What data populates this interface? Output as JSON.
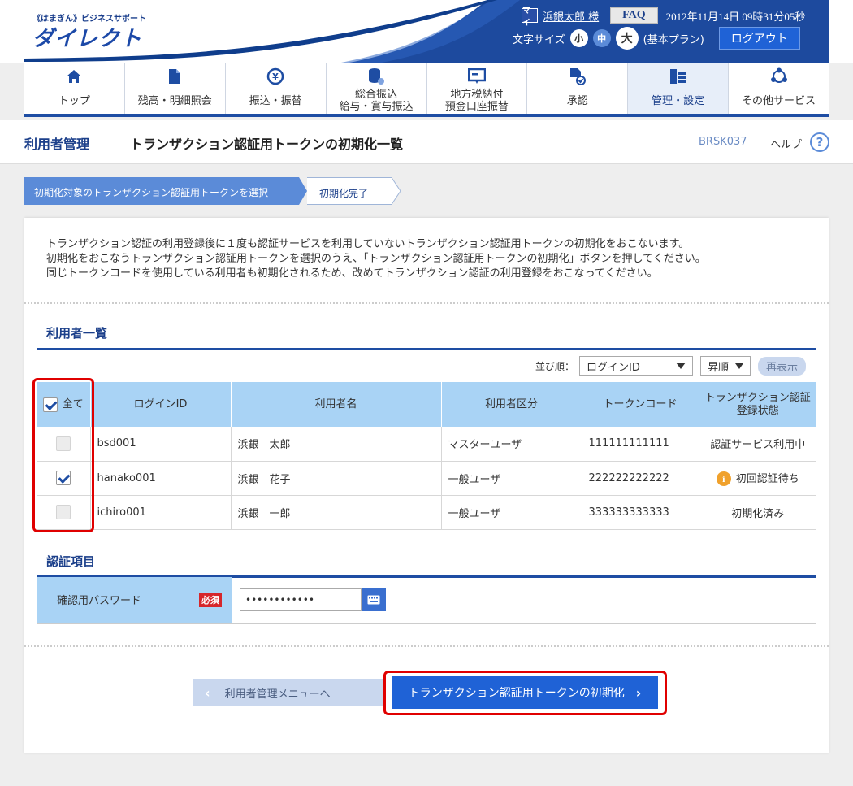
{
  "header": {
    "logo_sub": "《はまぎん》ビジネスサポート",
    "logo_main": "ダイレクト",
    "user_icon": "マイ",
    "user_name": "浜銀太郎 様",
    "faq": "FAQ",
    "datetime": "2012年11月14日 09時31分05秒",
    "font_size_label": "文字サイズ",
    "font_small": "小",
    "font_medium": "中",
    "font_large": "大",
    "plan": "(基本プラン)",
    "logout": "ログアウト"
  },
  "nav": [
    {
      "line1": "トップ",
      "line2": "",
      "icon": "home-icon"
    },
    {
      "line1": "残高・明細照会",
      "line2": "",
      "icon": "document-icon"
    },
    {
      "line1": "振込・振替",
      "line2": "",
      "icon": "yen-transfer-icon"
    },
    {
      "line1": "総合振込",
      "line2": "給与・賞与振込",
      "icon": "coins-icon"
    },
    {
      "line1": "地方税納付",
      "line2": "預金口座振替",
      "icon": "tax-icon"
    },
    {
      "line1": "承認",
      "line2": "",
      "icon": "approval-icon"
    },
    {
      "line1": "管理・設定",
      "line2": "",
      "icon": "settings-icon"
    },
    {
      "line1": "その他サービス",
      "line2": "",
      "icon": "services-icon"
    }
  ],
  "page": {
    "section": "利用者管理",
    "title": "トランザクション認証用トークンの初期化一覧",
    "code": "BRSK037",
    "help": "ヘルプ"
  },
  "steps": {
    "step1": "初期化対象のトランザクション認証用トークンを選択",
    "step2": "初期化完了"
  },
  "description": [
    "トランザクション認証の利用登録後に１度も認証サービスを利用していないトランザクション認証用トークンの初期化をおこないます。",
    "初期化をおこなうトランザクション認証用トークンを選択のうえ、「トランザクション認証用トークンの初期化」ボタンを押してください。",
    "同じトークンコードを使用している利用者も初期化されるため、改めてトランザクション認証の利用登録をおこなってください。"
  ],
  "users_section": {
    "title": "利用者一覧",
    "sort_label": "並び順：",
    "sort_value": "ログインID",
    "order_value": "昇順",
    "redisplay": "再表示",
    "columns": {
      "all": "全て",
      "login_id": "ログインID",
      "name": "利用者名",
      "type": "利用者区分",
      "token": "トークンコード",
      "status_line1": "トランザクション認証",
      "status_line2": "登録状態"
    },
    "rows": [
      {
        "login_id": "bsd001",
        "name": "浜銀　太郎",
        "type": "マスターユーザ",
        "token": "111111111111",
        "status": "認証サービス利用中"
      },
      {
        "login_id": "hanako001",
        "name": "浜銀　花子",
        "type": "一般ユーザ",
        "token": "222222222222",
        "status": "初回認証待ち"
      },
      {
        "login_id": "ichiro001",
        "name": "浜銀　一郎",
        "type": "一般ユーザ",
        "token": "333333333333",
        "status": "初期化済み"
      }
    ]
  },
  "auth_section": {
    "title": "認証項目",
    "password_label": "確認用パスワード",
    "required": "必須",
    "password_value": "••••••••••••"
  },
  "buttons": {
    "back": "利用者管理メニューへ",
    "submit": "トランザクション認証用トークンの初期化"
  },
  "colors": {
    "brand": "#1e4da3",
    "accent": "#1f62d6",
    "table_header": "#a9d3f5",
    "highlight": "#e00000"
  }
}
